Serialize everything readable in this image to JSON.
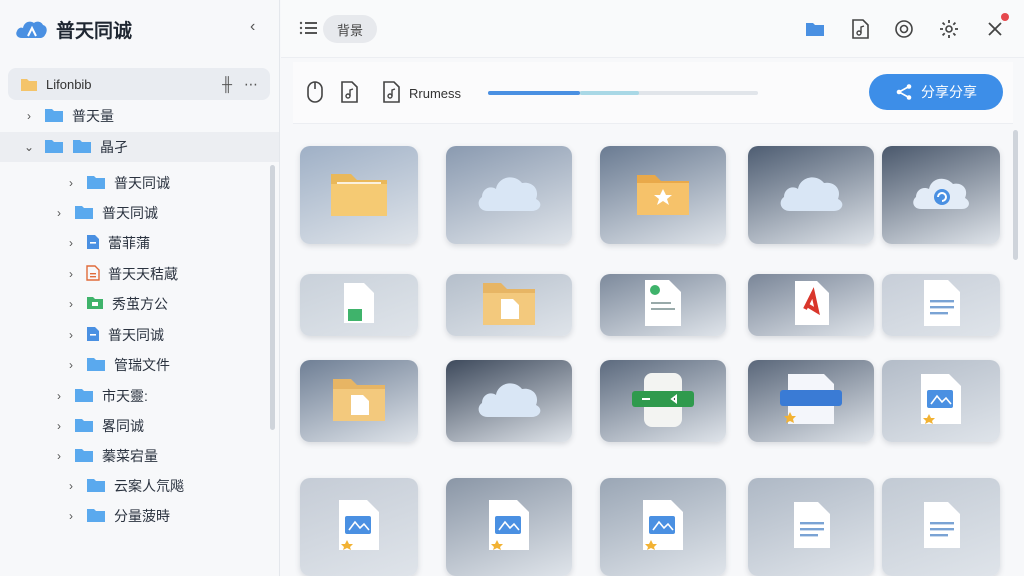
{
  "app": {
    "title": "普天同诚"
  },
  "sidebar": {
    "root": {
      "label": "Lifonbib"
    },
    "items": [
      {
        "label": "普天量",
        "chev": "›",
        "level": 0,
        "folder_color": "#5aa9ee"
      },
      {
        "label": "晶孑",
        "chev": "⌄",
        "level": 0,
        "folder_color": "#5aa9ee",
        "selected": true
      },
      {
        "label": "普天同诚",
        "chev": "›",
        "level": 2,
        "folder_color": "#5aa9ee"
      },
      {
        "label": "普天同诚",
        "chev": "›",
        "level": 1,
        "folder_color": "#5aa9ee"
      },
      {
        "label": "蕾菲蒲",
        "chev": "›",
        "level": 2,
        "icon": "doc-blue"
      },
      {
        "label": "普天天秸蔵",
        "chev": "›",
        "level": 2,
        "icon": "doc-orange"
      },
      {
        "label": "秀茧方公",
        "chev": "›",
        "level": 2,
        "icon": "folder-green"
      },
      {
        "label": "普天同诚",
        "chev": "›",
        "level": 2,
        "icon": "doc-blue"
      },
      {
        "label": "管瑞文件",
        "chev": "›",
        "level": 2,
        "folder_color": "#5aa9ee"
      },
      {
        "label": "市天靈:",
        "chev": "›",
        "level": 1,
        "folder_color": "#5aa9ee"
      },
      {
        "label": "畧同诚",
        "chev": "›",
        "level": 1,
        "folder_color": "#5aa9ee"
      },
      {
        "label": "蓁菜宕量",
        "chev": "›",
        "level": 1,
        "folder_color": "#5aa9ee"
      },
      {
        "label": "云案人氘飚",
        "chev": "›",
        "level": 2,
        "folder_color": "#5aa9ee"
      },
      {
        "label": "分量菠時",
        "chev": "›",
        "level": 2,
        "folder_color": "#5aa9ee"
      }
    ]
  },
  "topbar": {
    "search_label": "背景",
    "icons": [
      "folder-icon",
      "music-file-icon",
      "sync-icon",
      "settings-icon",
      "close-icon"
    ]
  },
  "toolbar": {
    "progress_label": "Rrumess",
    "progress_value": 0.34,
    "progress_secondary": 0.56,
    "share_label": "分享分享"
  },
  "tiles": [
    {
      "bg": "#9fb0c6",
      "icon": "folder"
    },
    {
      "bg": "#8a9ab0",
      "icon": "cloud"
    },
    {
      "bg": "#6a7b92",
      "icon": "folder-star"
    },
    {
      "bg": "#4e5d72",
      "icon": "cloud"
    },
    {
      "bg": "#4a586c",
      "icon": "cloud-sync"
    },
    {
      "bg": "#c9d1da",
      "icon": "doc-green"
    },
    {
      "bg": "#b5bfcb",
      "icon": "folder-doc"
    },
    {
      "bg": "#7d8a9c",
      "icon": "doc-green-circle"
    },
    {
      "bg": "#7a8698",
      "icon": "pdf"
    },
    {
      "bg": "#c7ced8",
      "icon": "doc-lines"
    },
    {
      "bg": "#6f7f95",
      "icon": "folder-doc"
    },
    {
      "bg": "#3e4a5c",
      "icon": "cloud"
    },
    {
      "bg": "#5c6a7e",
      "icon": "scroll-green"
    },
    {
      "bg": "#5a677a",
      "icon": "doc-blue-band"
    },
    {
      "bg": "#b3bcc8",
      "icon": "doc-image"
    },
    {
      "bg": "#c5ccd6",
      "icon": "doc-image"
    },
    {
      "bg": "#8a96a6",
      "icon": "doc-image"
    },
    {
      "bg": "#9aa6b5",
      "icon": "doc-image"
    },
    {
      "bg": "#aeb8c5",
      "icon": "doc-lines"
    },
    {
      "bg": "#c2cad4",
      "icon": "doc-lines"
    }
  ]
}
